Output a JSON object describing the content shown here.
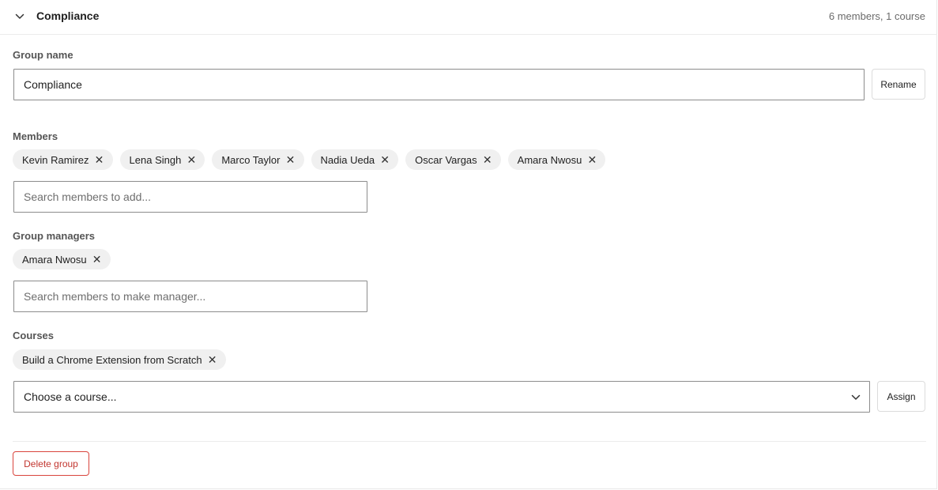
{
  "header": {
    "title": "Compliance",
    "meta": "6 members, 1 course"
  },
  "group_name": {
    "label": "Group name",
    "value": "Compliance",
    "rename_label": "Rename"
  },
  "members": {
    "label": "Members",
    "chips": [
      "Kevin Ramirez",
      "Lena Singh",
      "Marco Taylor",
      "Nadia Ueda",
      "Oscar Vargas",
      "Amara Nwosu"
    ],
    "search_placeholder": "Search members to add..."
  },
  "managers": {
    "label": "Group managers",
    "chips": [
      "Amara Nwosu"
    ],
    "search_placeholder": "Search members to make manager..."
  },
  "courses": {
    "label": "Courses",
    "chips": [
      "Build a Chrome Extension from Scratch"
    ],
    "select_value": "Choose a course...",
    "assign_label": "Assign"
  },
  "footer": {
    "delete_label": "Delete group"
  },
  "icons": {
    "collapse": "chevron-down-icon",
    "remove": "close-icon",
    "dropdown": "chevron-down-icon"
  }
}
